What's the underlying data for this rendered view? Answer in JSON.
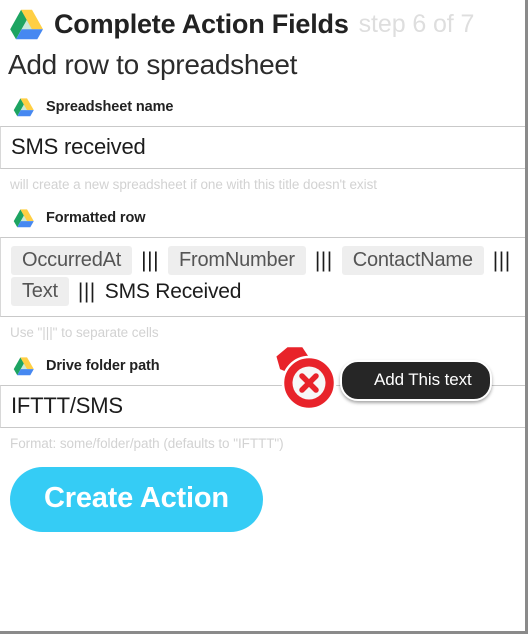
{
  "window": {
    "header": {
      "logo_icon": "google-drive-icon",
      "title": "Complete Action Fields",
      "step": "step 6 of 7"
    },
    "subtitle": "Add row to spreadsheet"
  },
  "fields": [
    {
      "icon": "google-drive-icon",
      "label": "Spreadsheet name",
      "value": "SMS received",
      "hint": "will create a new spreadsheet if one with this title doesn't exist"
    },
    {
      "icon": "google-drive-icon",
      "label": "Formatted row",
      "hint": "Use \"|||\" to separate cells",
      "tokens": [
        {
          "type": "chip",
          "text": "OccurredAt"
        },
        {
          "type": "sep",
          "text": "|||"
        },
        {
          "type": "chip",
          "text": "FromNumber"
        },
        {
          "type": "sep",
          "text": "|||"
        },
        {
          "type": "chip",
          "text": "ContactName"
        },
        {
          "type": "sep",
          "text": "|||"
        },
        {
          "type": "chip",
          "text": "Text"
        },
        {
          "type": "sep",
          "text": "|||"
        },
        {
          "type": "plain",
          "text": "SMS Received"
        }
      ]
    },
    {
      "icon": "google-drive-icon",
      "label": "Drive folder path",
      "value": "IFTTT/SMS",
      "hint": "Format: some/folder/path (defaults to \"IFTTT\")"
    }
  ],
  "actions": {
    "create_label": "Create Action"
  },
  "annotation": {
    "badge_icon": "red-x-marker-icon",
    "tooltip": "Add This text"
  },
  "colors": {
    "drive_green": "#1DA462",
    "drive_yellow": "#FFCF44",
    "drive_blue": "#4688F1",
    "button_blue": "#35CCF5",
    "chip_bg": "#EEEEEE",
    "hint_gray": "#D2D2D2",
    "step_gray": "#DEDEDE",
    "annotation_red": "#E8232A",
    "tooltip_bg": "#262626"
  }
}
